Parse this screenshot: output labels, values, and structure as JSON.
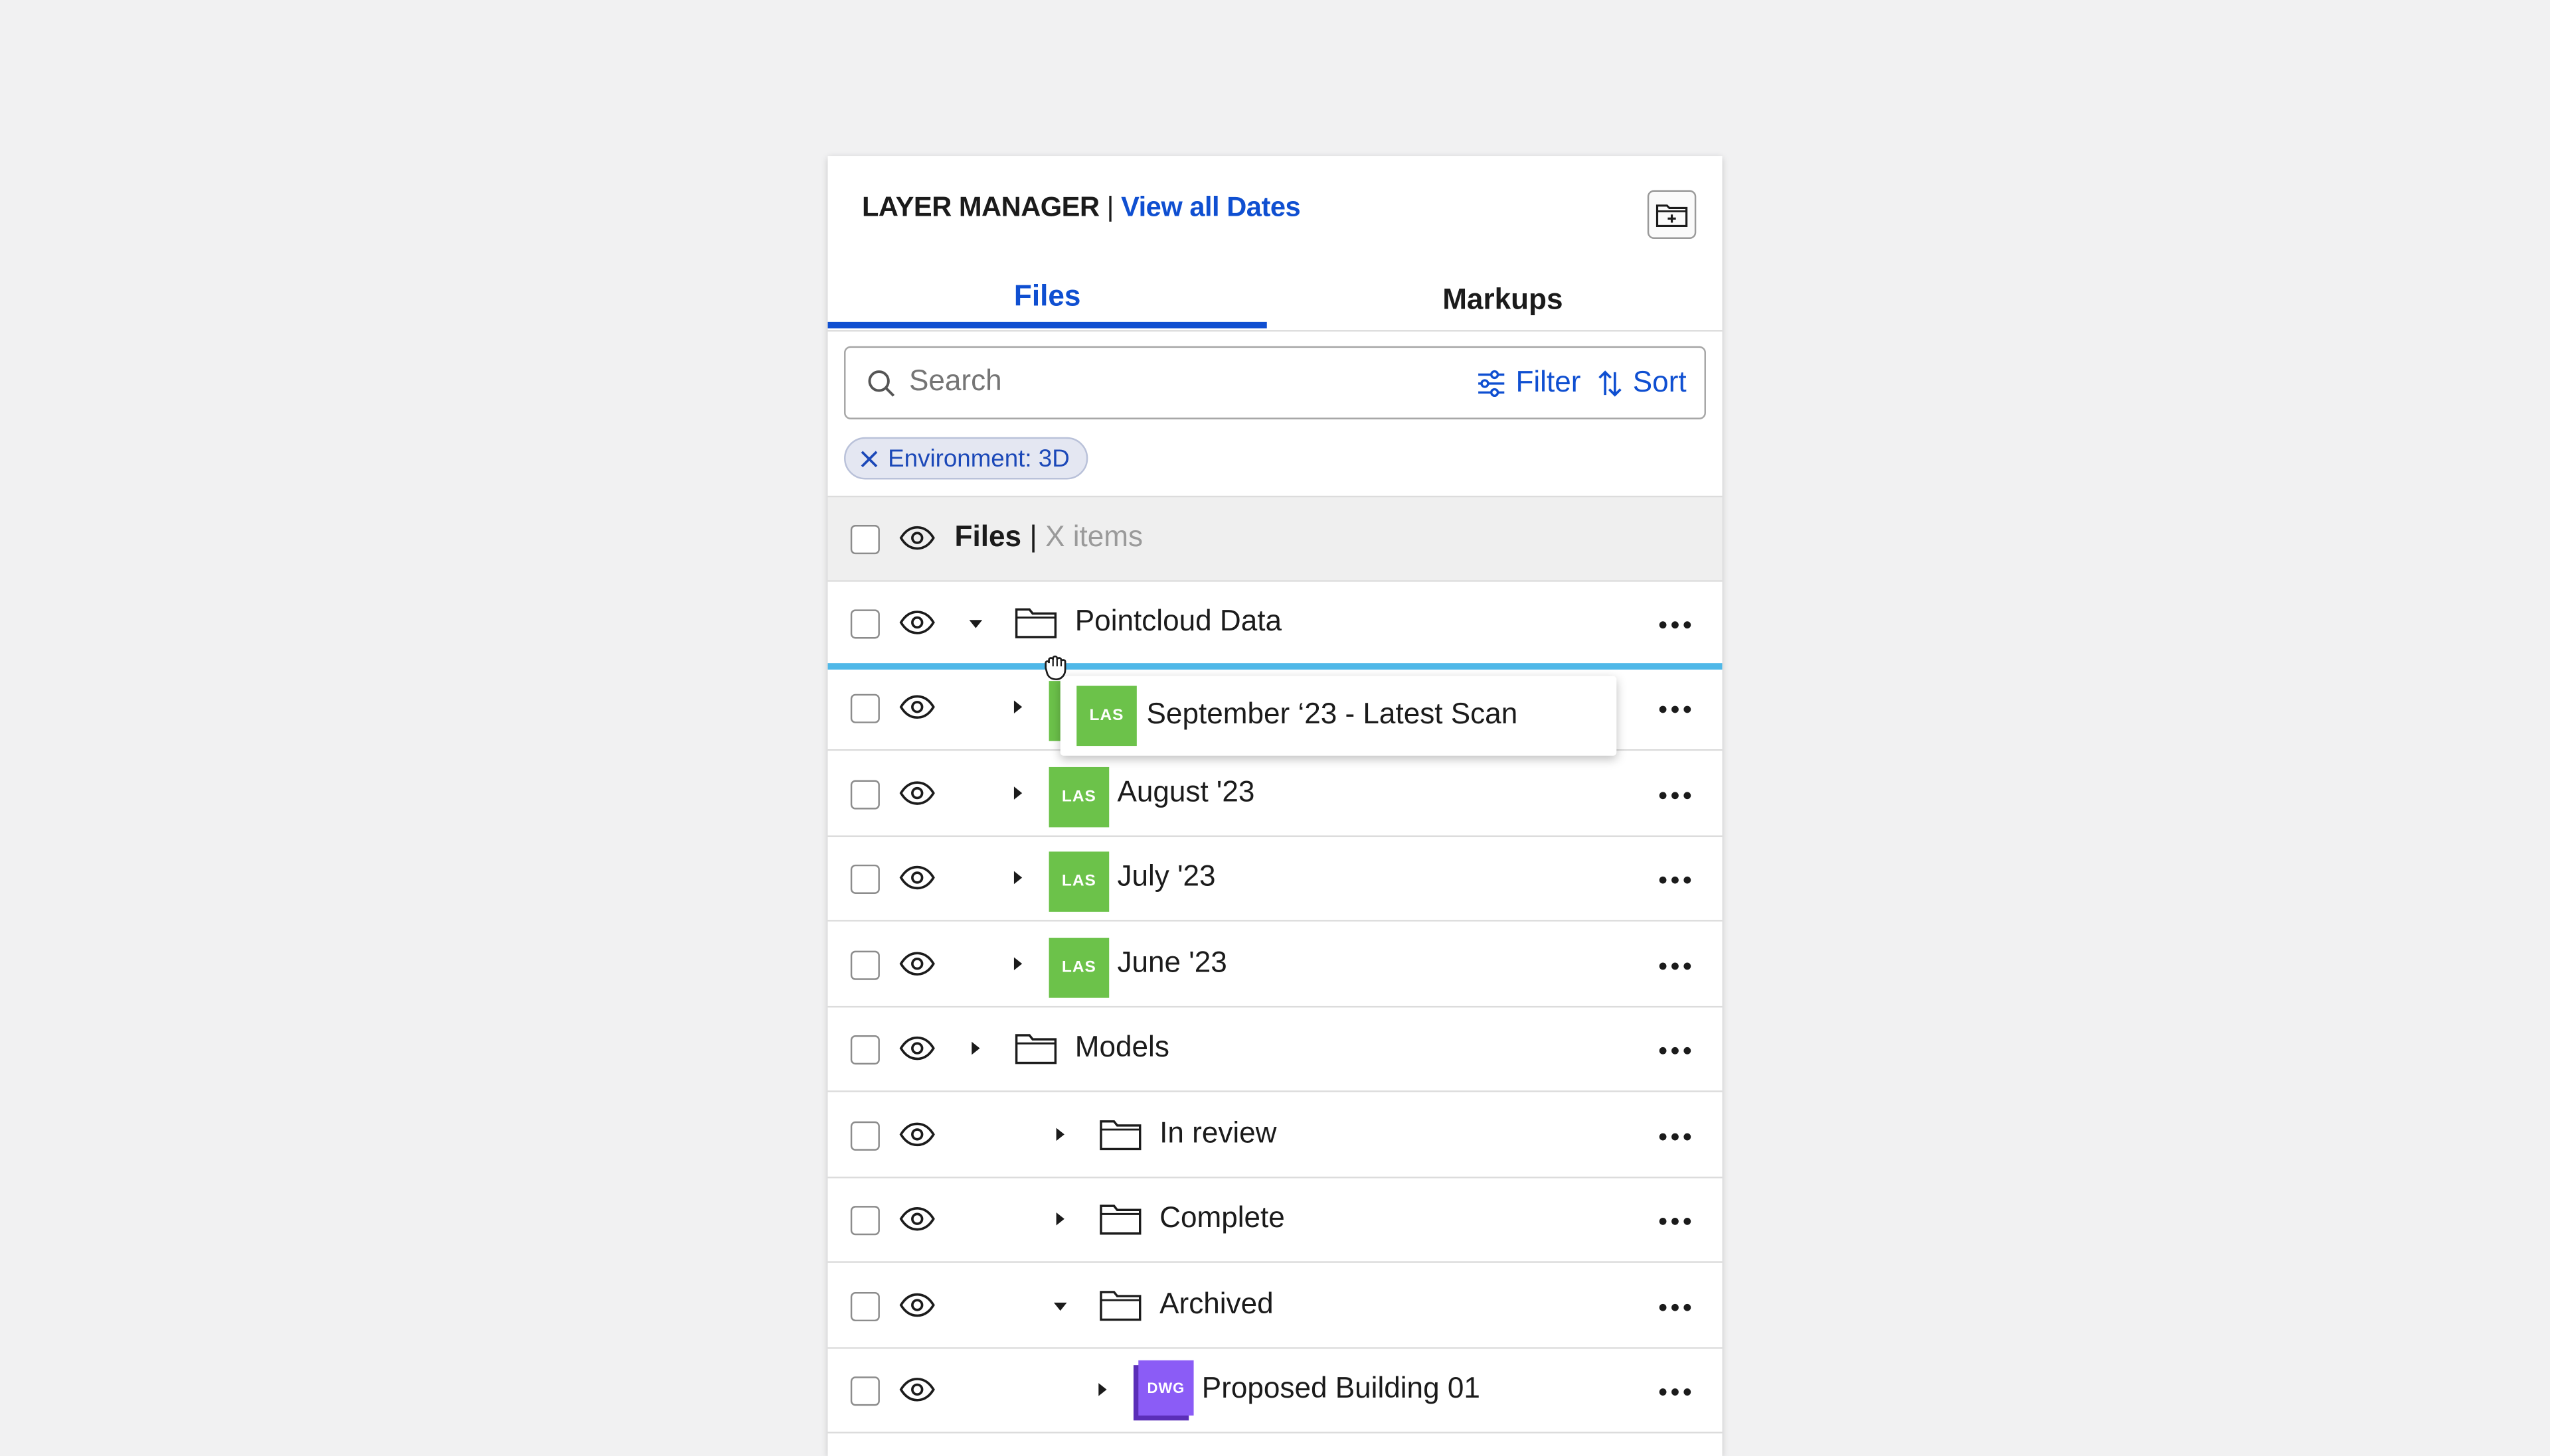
{
  "header": {
    "title": "LAYER MANAGER",
    "separator": "|",
    "link": "View all Dates",
    "add_folder_icon": "folder-plus-icon"
  },
  "tabs": [
    {
      "label": "Files",
      "active": true
    },
    {
      "label": "Markups",
      "active": false
    }
  ],
  "search": {
    "placeholder": "Search",
    "filter_label": "Filter",
    "sort_label": "Sort"
  },
  "chips": [
    {
      "label": "Environment: 3D"
    }
  ],
  "list_header": {
    "label": "Files",
    "separator": "|",
    "count": "X items"
  },
  "rows": [
    {
      "label": "Pointcloud Data",
      "type": "folder",
      "expanded": true
    },
    {
      "label": "",
      "type": "las",
      "expanded": false,
      "badge": "LAS"
    },
    {
      "label": "August '23",
      "type": "las",
      "expanded": false,
      "badge": "LAS"
    },
    {
      "label": "July '23",
      "type": "las",
      "expanded": false,
      "badge": "LAS"
    },
    {
      "label": "June '23",
      "type": "las",
      "expanded": false,
      "badge": "LAS"
    },
    {
      "label": "Models",
      "type": "folder",
      "expanded": false
    },
    {
      "label": "In review",
      "type": "folder",
      "expanded": false
    },
    {
      "label": "Complete",
      "type": "folder",
      "expanded": false
    },
    {
      "label": "Archived",
      "type": "folder",
      "expanded": true
    },
    {
      "label": "Proposed Building 01",
      "type": "dwg",
      "expanded": false,
      "badge": "DWG"
    }
  ],
  "drag_item": {
    "badge": "LAS",
    "label": "September ‘23 - Latest Scan"
  },
  "colors": {
    "accent": "#0f4fd1",
    "las": "#6cc24a",
    "dwg": "#8b5cf6",
    "drop_indicator": "#4fb8e8"
  }
}
